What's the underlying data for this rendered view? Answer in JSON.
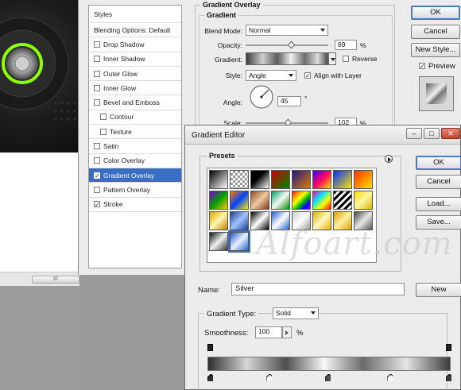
{
  "layer_style": {
    "styles_header": "Styles",
    "items": [
      {
        "label": "Blending Options: Default",
        "checkbox": false,
        "checked": false,
        "selected": false,
        "sub": false
      },
      {
        "label": "Drop Shadow",
        "checkbox": true,
        "checked": false,
        "selected": false,
        "sub": false
      },
      {
        "label": "Inner Shadow",
        "checkbox": true,
        "checked": false,
        "selected": false,
        "sub": false
      },
      {
        "label": "Outer Glow",
        "checkbox": true,
        "checked": false,
        "selected": false,
        "sub": false
      },
      {
        "label": "Inner Glow",
        "checkbox": true,
        "checked": false,
        "selected": false,
        "sub": false
      },
      {
        "label": "Bevel and Emboss",
        "checkbox": true,
        "checked": false,
        "selected": false,
        "sub": false
      },
      {
        "label": "Contour",
        "checkbox": true,
        "checked": false,
        "selected": false,
        "sub": true
      },
      {
        "label": "Texture",
        "checkbox": true,
        "checked": false,
        "selected": false,
        "sub": true
      },
      {
        "label": "Satin",
        "checkbox": true,
        "checked": false,
        "selected": false,
        "sub": false
      },
      {
        "label": "Color Overlay",
        "checkbox": true,
        "checked": false,
        "selected": false,
        "sub": false
      },
      {
        "label": "Gradient Overlay",
        "checkbox": true,
        "checked": true,
        "selected": true,
        "sub": false
      },
      {
        "label": "Pattern Overlay",
        "checkbox": true,
        "checked": false,
        "selected": false,
        "sub": false
      },
      {
        "label": "Stroke",
        "checkbox": true,
        "checked": true,
        "selected": false,
        "sub": false
      }
    ],
    "section_title": "Gradient Overlay",
    "group_title": "Gradient",
    "blend_mode_label": "Blend Mode:",
    "blend_mode_value": "Normal",
    "opacity_label": "Opacity:",
    "opacity_value": "69",
    "opacity_unit": "%",
    "gradient_label": "Gradient:",
    "reverse_label": "Reverse",
    "style_label": "Style:",
    "style_value": "Angle",
    "align_label": "Align with Layer",
    "angle_label": "Angle:",
    "angle_value": "45",
    "angle_unit": "°",
    "scale_label": "Scale:",
    "scale_value": "102",
    "scale_unit": "%",
    "ok": "OK",
    "cancel": "Cancel",
    "new_style": "New Style...",
    "preview": "Preview"
  },
  "gradient_editor": {
    "title": "Gradient Editor",
    "presets_label": "Presets",
    "ok": "OK",
    "cancel": "Cancel",
    "load": "Load...",
    "save": "Save...",
    "name_label": "Name:",
    "name_value": "Silver",
    "new_button": "New",
    "gradient_type_label": "Gradient Type:",
    "gradient_type_value": "Solid",
    "smoothness_label": "Smoothness:",
    "smoothness_value": "100",
    "smoothness_unit": "%",
    "watermark": "Alfoart.com"
  },
  "doc": {
    "scroll_thumb": "III"
  }
}
